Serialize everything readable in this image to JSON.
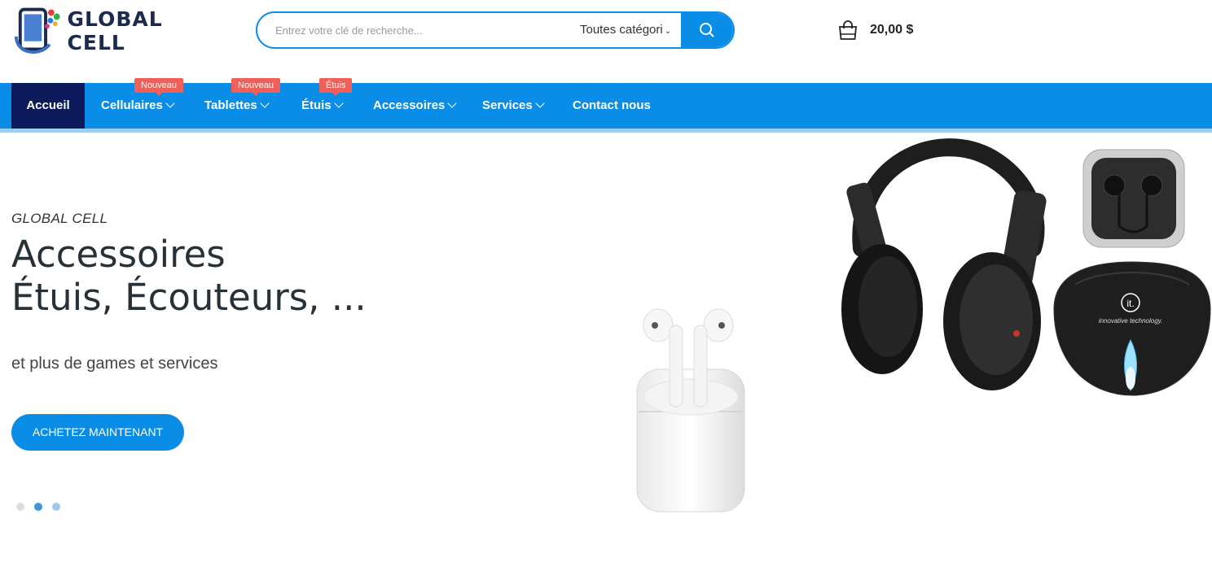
{
  "brand": {
    "name": "GLOBAL CELL"
  },
  "search": {
    "placeholder": "Entrez votre clé de recherche...",
    "category": "Toutes catégori",
    "icon": "search-icon"
  },
  "cart": {
    "total": "20,00 $",
    "icon": "shopping-bag-icon"
  },
  "nav": {
    "items": [
      {
        "label": "Accueil"
      },
      {
        "label": "Cellulaires",
        "badge": "Nouveau"
      },
      {
        "label": "Tablettes",
        "badge": "Nouveau"
      },
      {
        "label": "Étuis",
        "badge": "Étuis"
      },
      {
        "label": "Accessoires"
      },
      {
        "label": "Services"
      },
      {
        "label": "Contact nous"
      }
    ]
  },
  "hero": {
    "subtitle": "GLOBAL CELL",
    "title_line1": "Accessoires",
    "title_line2": "Étuis, Écouteurs, ...",
    "description": "et plus de games et services",
    "cta": "ACHETEZ MAINTENANT",
    "earphone_case_brand": "it.",
    "earphone_case_text": "innovative technology."
  },
  "colors": {
    "accent": "#0a8de6",
    "nav_active": "#0c1a5c",
    "badge": "#f0605a",
    "brand_text": "#1b2a4e"
  }
}
